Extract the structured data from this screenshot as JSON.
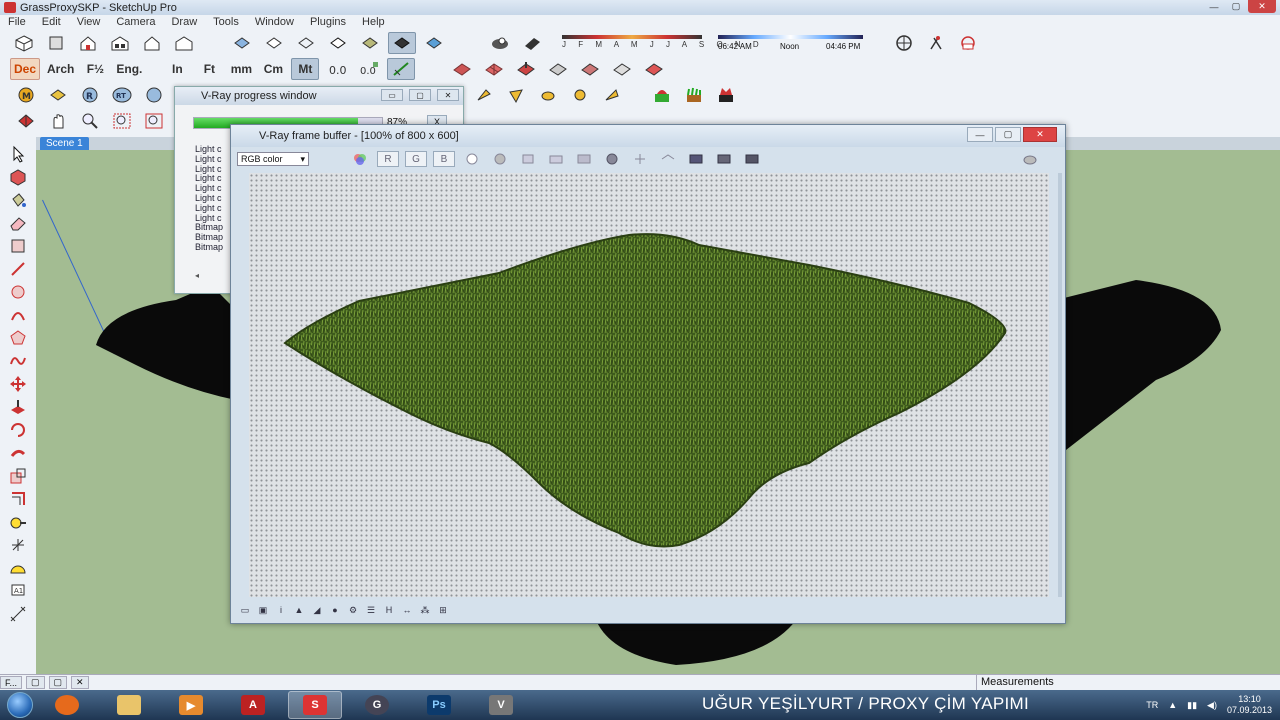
{
  "window": {
    "title": "GrassProxySKP - SketchUp Pro"
  },
  "menu": [
    "File",
    "Edit",
    "View",
    "Camera",
    "Draw",
    "Tools",
    "Window",
    "Plugins",
    "Help"
  ],
  "units_toolbar": {
    "dec": "Dec",
    "arch": "Arch",
    "frac": "F½",
    "eng": "Eng.",
    "in": "In",
    "ft": "Ft",
    "mm": "mm",
    "cm": "Cm",
    "mt": "Mt"
  },
  "shadow": {
    "months": "J F M A M J J A S O N D",
    "time_start": "06:42 AM",
    "time_mid": "Noon",
    "time_end": "04:46 PM"
  },
  "scene_tab": "Scene 1",
  "progress_window": {
    "title": "V-Ray progress window",
    "percent": "87%",
    "progress": 0.87,
    "close_label": "X",
    "log": [
      "Light c",
      "Light c",
      "Light c",
      "Light c",
      "Light c",
      "Light c",
      "Light c",
      "Light c",
      "Bitmap",
      "Bitmap",
      "Bitmap"
    ]
  },
  "frame_buffer": {
    "title": "V-Ray frame buffer - [100% of 800 x 600]",
    "channel_select": "RGB color",
    "r_label": "R",
    "g_label": "G",
    "b_label": "B"
  },
  "statusbar": {
    "measurements_label": "Measurements"
  },
  "taskbar": {
    "caption": "UĞUR YEŞİLYURT / PROXY ÇİM YAPIMI",
    "lang": "TR",
    "time": "13:10",
    "date": "07.09.2013"
  },
  "colors": {
    "viewport_bg": "#a3bc92",
    "grass_dark": "#2f4a17",
    "grass_light": "#7fa23a",
    "taskbar": "#1f3652"
  }
}
